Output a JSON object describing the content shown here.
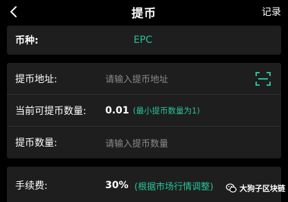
{
  "header": {
    "title": "提币",
    "back_icon": "chevron-left-icon",
    "record_label": "记录"
  },
  "coin": {
    "label": "币种:",
    "value": "EPC"
  },
  "form": {
    "address_label": "提币地址:",
    "address_placeholder": "请输入提币地址",
    "scan_icon": "scan-icon",
    "available_label": "当前可提币数量:",
    "available_value": "0.01",
    "min_note": "(最小提币数量为1)",
    "amount_label": "提币数量:",
    "amount_placeholder": "请输入提币数量"
  },
  "fee": {
    "label": "手续费:",
    "value": "30%",
    "note": "(根据市场行情调整)"
  },
  "watermark": {
    "text": "大狗子区块链",
    "icon": "wechat-icon"
  },
  "colors": {
    "background": "#000000",
    "card": "#1e1e1e",
    "accent": "#27c39a",
    "placeholder": "#8a8a8a"
  }
}
